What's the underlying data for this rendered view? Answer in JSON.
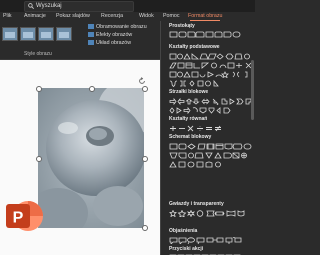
{
  "titlebar": {
    "search_value": "Wyszukaj"
  },
  "tabs": [
    {
      "label": "Plik"
    },
    {
      "label": "Animacje"
    },
    {
      "label": "Pokaz slajdów"
    },
    {
      "label": "Recenzja"
    },
    {
      "label": "Widok"
    },
    {
      "label": "Pomoc"
    },
    {
      "label": "Format obrazu",
      "active": true
    }
  ],
  "ribbon": {
    "picture_border": "Obramowanie obrazu",
    "picture_effects": "Efekty obrazów",
    "picture_layout": "Układ obrazów",
    "styles_group": "Style obrazu"
  },
  "shapes_panel": {
    "sections": [
      {
        "title": "Prostokąty"
      },
      {
        "title": "Kształty podstawowe"
      },
      {
        "title": "Strzałki blokowe"
      },
      {
        "title": "Kształty równań"
      },
      {
        "title": "Schemat blokowy"
      },
      {
        "title": "Gwiazdy i transparenty"
      },
      {
        "title": "Objaśnienia"
      },
      {
        "title": "Przyciski akcji"
      }
    ]
  },
  "colors": {
    "accent": "#f08a65",
    "panel": "#2b2b2b",
    "ppt_orange": "#d24726"
  },
  "icons": {
    "search": "search-icon",
    "rotate": "rotate-handle-icon",
    "app": "powerpoint-logo-icon"
  }
}
